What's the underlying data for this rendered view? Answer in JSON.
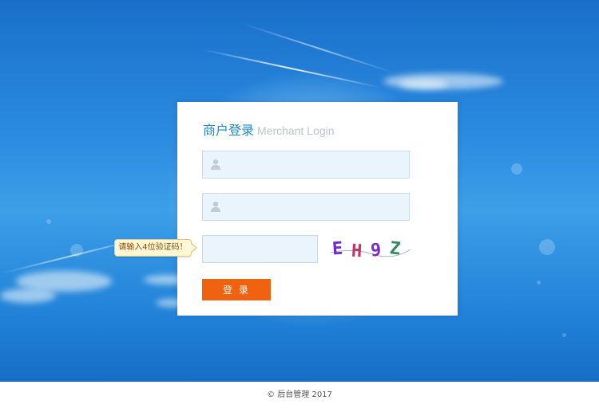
{
  "login": {
    "title_cn": "商户登录",
    "title_en": "Merchant Login",
    "username_placeholder": "",
    "password_placeholder": "",
    "captcha_placeholder": "",
    "captcha_text": "EH9Z",
    "captcha_chars": [
      "E",
      "H",
      "9",
      "Z"
    ],
    "submit_label": "登 录"
  },
  "tooltip": {
    "text": "请输入4位验证码！"
  },
  "footer": {
    "text": "© 后台管理 2017"
  },
  "colors": {
    "accent": "#1f8ad6",
    "button": "#f0620f",
    "input_bg": "#eaf4fd"
  },
  "icons": {
    "username": "user-icon",
    "password": "user-icon"
  }
}
